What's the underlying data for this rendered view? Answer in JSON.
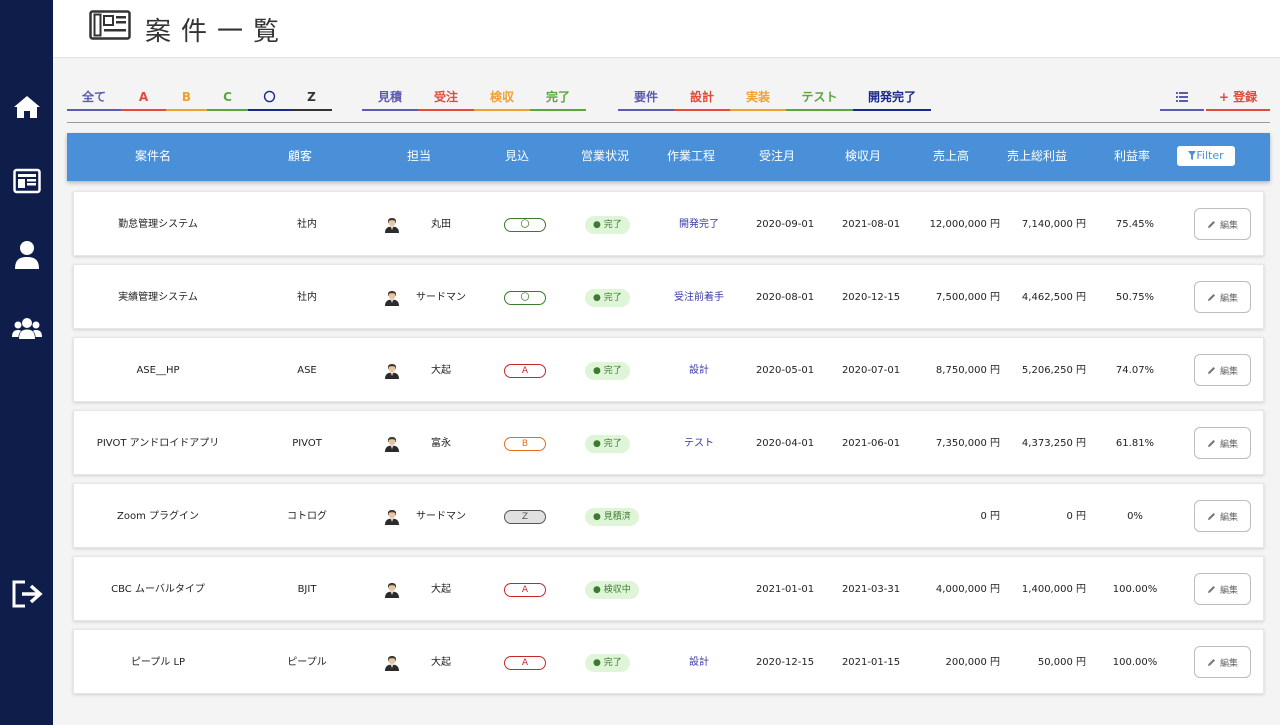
{
  "header": {
    "title": "案件一覧"
  },
  "sidebar": {
    "items": [
      "home-icon",
      "list-icon",
      "user-icon",
      "users-icon",
      "logout-icon"
    ]
  },
  "filters": {
    "group1": [
      {
        "label": "全て",
        "color": "#5b5bb3"
      },
      {
        "label": "A",
        "color": "#e24b3b"
      },
      {
        "label": "B",
        "color": "#f0a030"
      },
      {
        "label": "C",
        "color": "#5aa63c"
      },
      {
        "label": "〇",
        "color": "#1b2a8a"
      },
      {
        "label": "Z",
        "color": "#333333"
      }
    ],
    "group2": [
      {
        "label": "見積",
        "color": "#5b5bb3"
      },
      {
        "label": "受注",
        "color": "#e24b3b"
      },
      {
        "label": "検収",
        "color": "#f0a030"
      },
      {
        "label": "完了",
        "color": "#5aa63c"
      }
    ],
    "group3": [
      {
        "label": "要件",
        "color": "#5b5bb3"
      },
      {
        "label": "設計",
        "color": "#e24b3b"
      },
      {
        "label": "実装",
        "color": "#f0a030"
      },
      {
        "label": "テスト",
        "color": "#5aa63c"
      },
      {
        "label": "開発完了",
        "color": "#1b2a8a"
      }
    ],
    "list_icon_color": "#5b5bb3",
    "register_label": "+ 登録",
    "register_color": "#e24b3b"
  },
  "table": {
    "columns": [
      "案件名",
      "顧客",
      "担当",
      "見込",
      "営業状況",
      "作業工程",
      "受注月",
      "検収月",
      "売上高",
      "売上総利益",
      "利益率"
    ],
    "filter_label": "Filter",
    "edit_label": "編集",
    "rows": [
      {
        "name": "勤怠管理システム",
        "client": "社内",
        "staff": "丸田",
        "mikomi": "〇",
        "status": "● 完了",
        "process": "開発完了",
        "order_month": "2020-09-01",
        "accept_month": "2021-08-01",
        "sales": "12,000,000 円",
        "profit": "7,140,000 円",
        "rate": "75.45%"
      },
      {
        "name": "実績管理システム",
        "client": "社内",
        "staff": "サードマン",
        "mikomi": "〇",
        "status": "● 完了",
        "process": "受注前着手",
        "order_month": "2020-08-01",
        "accept_month": "2020-12-15",
        "sales": "7,500,000 円",
        "profit": "4,462,500 円",
        "rate": "50.75%"
      },
      {
        "name": "ASE__HP",
        "client": "ASE",
        "staff": "大起",
        "mikomi": "A",
        "status": "● 完了",
        "process": "設計",
        "order_month": "2020-05-01",
        "accept_month": "2020-07-01",
        "sales": "8,750,000 円",
        "profit": "5,206,250 円",
        "rate": "74.07%"
      },
      {
        "name": "PIVOT アンドロイドアプリ",
        "client": "PIVOT",
        "staff": "富永",
        "mikomi": "B",
        "status": "● 完了",
        "process": "テスト",
        "order_month": "2020-04-01",
        "accept_month": "2021-06-01",
        "sales": "7,350,000 円",
        "profit": "4,373,250 円",
        "rate": "61.81%"
      },
      {
        "name": "Zoom プラグイン",
        "client": "コトログ",
        "staff": "サードマン",
        "mikomi": "Z",
        "status": "● 見積済",
        "process": "",
        "order_month": "",
        "accept_month": "",
        "sales": "0 円",
        "profit": "0 円",
        "rate": "0%"
      },
      {
        "name": "CBC ムーバルタイプ",
        "client": "BJIT",
        "staff": "大起",
        "mikomi": "A",
        "status": "● 検収中",
        "process": "",
        "order_month": "2021-01-01",
        "accept_month": "2021-03-31",
        "sales": "4,000,000 円",
        "profit": "1,400,000 円",
        "rate": "100.00%"
      },
      {
        "name": "ピープル LP",
        "client": "ピープル",
        "staff": "大起",
        "mikomi": "A",
        "status": "● 完了",
        "process": "設計",
        "order_month": "2020-12-15",
        "accept_month": "2021-01-15",
        "sales": "200,000 円",
        "profit": "50,000 円",
        "rate": "100.00%"
      }
    ]
  },
  "colors": {
    "sidebar": "#0f1d4a",
    "table_header": "#4a90d9",
    "mikomi": {
      "〇": "#3a7a2a",
      "A": "#c62828",
      "B": "#e07020",
      "Z": "#555555"
    },
    "status_text": "#3e7a32",
    "process_text": "#3a3aa8"
  }
}
